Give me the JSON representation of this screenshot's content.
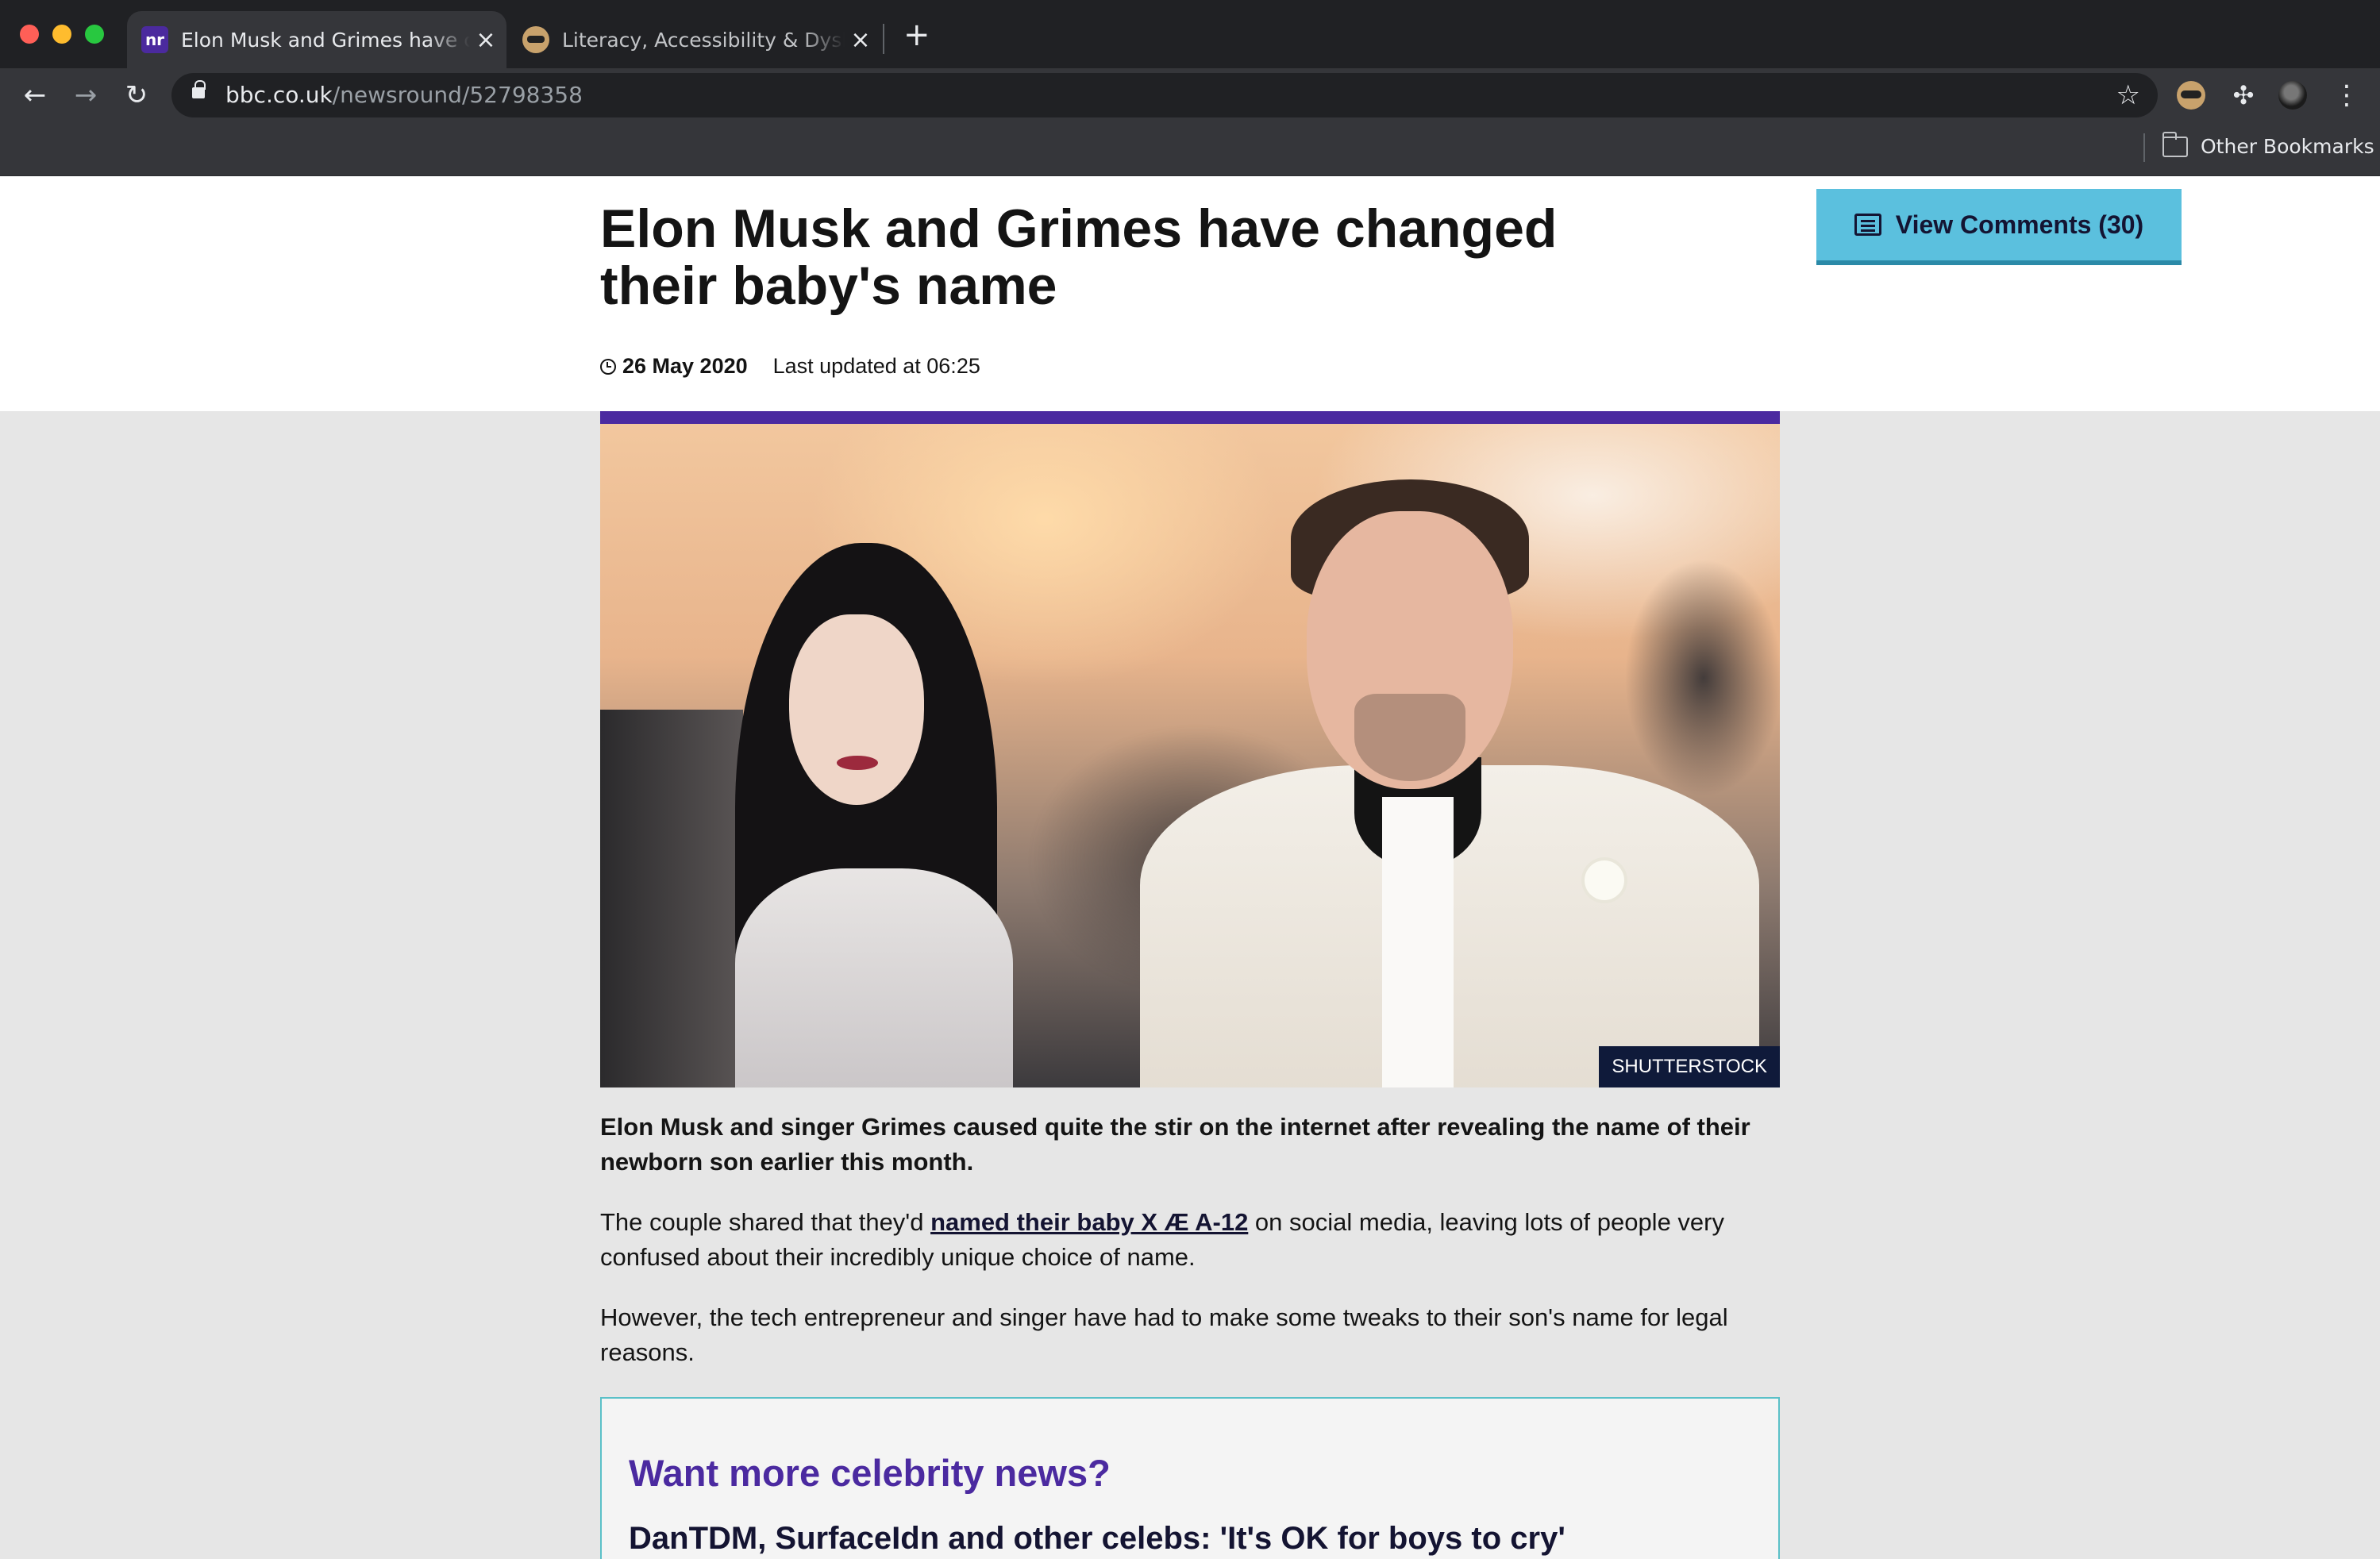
{
  "browser": {
    "tabs": [
      {
        "title": "Elon Musk and Grimes have changed their baby's name",
        "favicon": "nr",
        "active": true
      },
      {
        "title": "Literacy, Accessibility & Dyslexia",
        "favicon": "glasses-extension",
        "active": false
      }
    ],
    "url": {
      "domain": "bbc.co.uk",
      "path": "/newsround/52798358"
    },
    "bookmarks": {
      "other_label": "Other Bookmarks"
    }
  },
  "article": {
    "headline": "Elon Musk and Grimes have changed their baby's name",
    "date": "26 May 2020",
    "updated": "Last updated at 06:25",
    "comments_button": "View Comments (30)",
    "image_credit": "SHUTTERSTOCK",
    "intro": "Elon Musk and singer Grimes caused quite the stir on the internet after revealing the name of their newborn son earlier this month.",
    "para1_before": "The couple shared that they'd ",
    "para1_link": "named their baby X Æ A-12",
    "para1_after": " on social media, leaving lots of people very confused about their incredibly unique choice of name.",
    "para2": "However, the tech entrepreneur and singer have had to make some tweaks to their son's name for legal reasons."
  },
  "promo": {
    "title": "Want more celebrity news?",
    "link": "DanTDM, SurfaceIdn and other celebs: 'It's OK for boys to cry'"
  },
  "colors": {
    "newsround_purple": "#4b2aa0",
    "comments_button": "#5bc0de",
    "promo_border": "#5bc0c8",
    "page_background": "#e6e6e6"
  }
}
